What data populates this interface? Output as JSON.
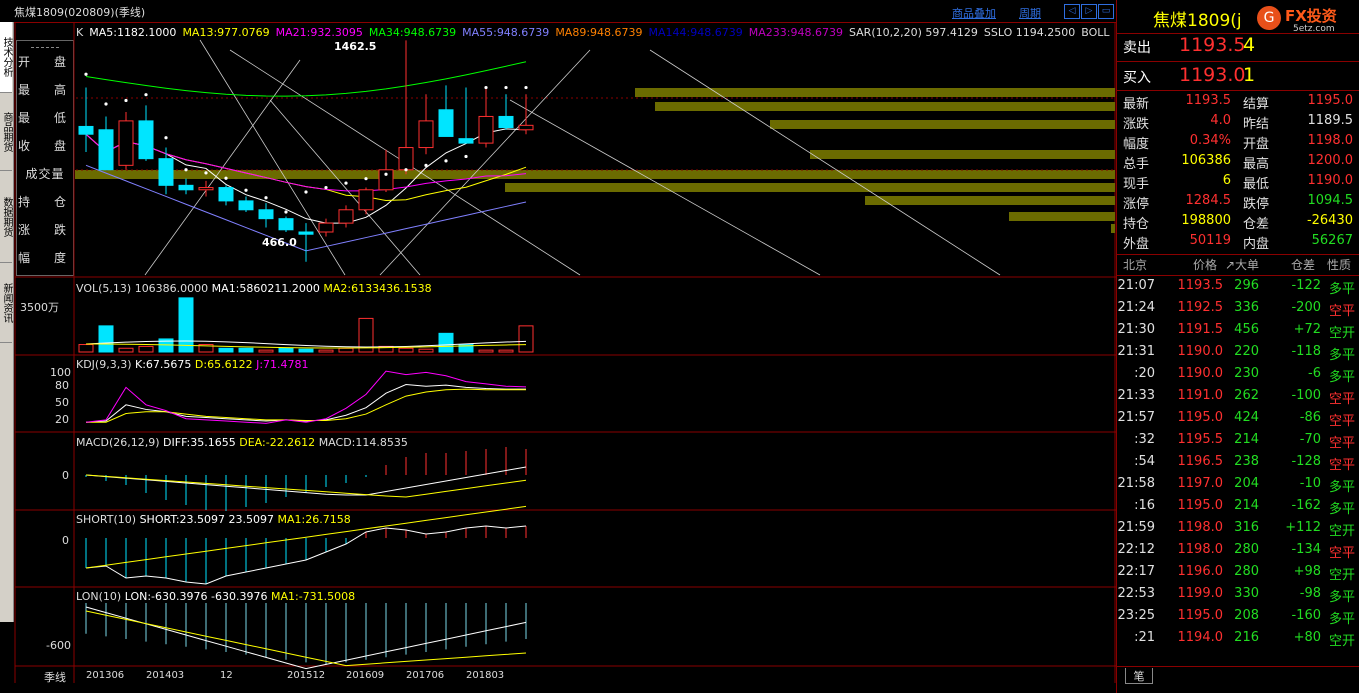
{
  "window": {
    "title": "焦煤1809(020809)(季线)",
    "links": [
      "商品叠加",
      "周期"
    ],
    "nav_buttons": [
      "◁",
      "▷",
      "▭"
    ]
  },
  "left_tabs": [
    "技术分析",
    "商品期货",
    "数据期货",
    "新闻资讯"
  ],
  "info_labels": [
    "开　盘",
    "最　高",
    "最　低",
    "收　盘",
    "成交量",
    "持　仓",
    "涨　跌",
    "幅　度"
  ],
  "main_pane": {
    "indicator_line": [
      {
        "text": "K",
        "color": "#dddddd"
      },
      {
        "text": "MA5:1182.1000",
        "color": "#ffffff"
      },
      {
        "text": "MA13:977.0769",
        "color": "#ffff00"
      },
      {
        "text": "MA21:932.3095",
        "color": "#ff00ff"
      },
      {
        "text": "MA34:948.6739",
        "color": "#00ff00"
      },
      {
        "text": "MA55:948.6739",
        "color": "#8080ff"
      },
      {
        "text": "MA89:948.6739",
        "color": "#ff8000"
      },
      {
        "text": "MA144:948.6739",
        "color": "#0000c0"
      },
      {
        "text": "MA233:948.6739",
        "color": "#c000c0"
      },
      {
        "text": "SAR(10,2,20) 597.4129",
        "color": "#dddddd"
      },
      {
        "text": "SSLO 1194.2500",
        "color": "#dddddd"
      },
      {
        "text": "BOLL",
        "color": "#dddddd"
      }
    ],
    "high_mark": "1462.5",
    "low_mark": "466.0"
  },
  "vol_pane": {
    "title": "VOL(5,13) 106386.0000",
    "ma1": "MA1:5860211.2000",
    "ma2": "MA2:6133436.1538",
    "ylabel": "3500万"
  },
  "kdj_pane": {
    "title": "KDJ(9,3,3)",
    "k": "K:67.5675",
    "d": "D:65.6122",
    "j": "J:71.4781",
    "yticks": [
      "100",
      "80",
      "50",
      "20"
    ]
  },
  "macd_pane": {
    "title": "MACD(26,12,9)",
    "diff": "DIFF:35.1655",
    "dea": "DEA:-22.2612",
    "macd": "MACD:114.8535",
    "ytick": "0"
  },
  "short_pane": {
    "title": "SHORT(10)",
    "v": "SHORT:23.5097",
    "v2": "23.5097",
    "ma": "MA1:26.7158",
    "ytick": "0"
  },
  "lon_pane": {
    "title": "LON(10)",
    "v": "LON:-630.3976",
    "v2": "-630.3976",
    "ma": "MA1:-731.5008",
    "ytick": "-600"
  },
  "x_axis": {
    "period_label": "季线",
    "dates": [
      "201306",
      "201403",
      "12",
      "201512",
      "201609",
      "201706",
      "201803"
    ]
  },
  "quote": {
    "name": "焦煤1809",
    "code_suffix": "(j",
    "logo_text": "FX投资",
    "logo_sub": "5etz.com",
    "sell_label": "卖出",
    "sell_price": "1193.5",
    "sell_qty": "4",
    "buy_label": "买入",
    "buy_price": "1193.0",
    "buy_qty": "1",
    "fields": [
      {
        "l1": "最新",
        "v1": "1193.5",
        "c1": "red",
        "l2": "结算",
        "v2": "1195.0",
        "c2": "red"
      },
      {
        "l1": "涨跌",
        "v1": "4.0",
        "c1": "red",
        "l2": "昨结",
        "v2": "1189.5",
        "c2": "wht"
      },
      {
        "l1": "幅度",
        "v1": "0.34%",
        "c1": "red",
        "l2": "开盘",
        "v2": "1198.0",
        "c2": "red"
      },
      {
        "l1": "总手",
        "v1": "106386",
        "c1": "yel",
        "l2": "最高",
        "v2": "1200.0",
        "c2": "red"
      },
      {
        "l1": "现手",
        "v1": "6",
        "c1": "yel",
        "l2": "最低",
        "v2": "1190.0",
        "c2": "red"
      },
      {
        "l1": "涨停",
        "v1": "1284.5",
        "c1": "red",
        "l2": "跌停",
        "v2": "1094.5",
        "c2": "grn"
      },
      {
        "l1": "持仓",
        "v1": "198800",
        "c1": "yel",
        "l2": "仓差",
        "v2": "-26430",
        "c2": "yel"
      },
      {
        "l1": "外盘",
        "v1": "50119",
        "c1": "red",
        "l2": "内盘",
        "v2": "56267",
        "c2": "grn"
      }
    ],
    "tick_headers": [
      "北京",
      "价格",
      "↗大单",
      "仓差",
      "性质"
    ],
    "ticks": [
      {
        "t": "21:07",
        "p": "1193.5",
        "v": "296",
        "d": "-122",
        "n": "多平",
        "pc": "red",
        "nc": "grn"
      },
      {
        "t": "21:24",
        "p": "1192.5",
        "v": "336",
        "d": "-200",
        "n": "空平",
        "pc": "red",
        "nc": "red"
      },
      {
        "t": "21:30",
        "p": "1191.5",
        "v": "456",
        "d": "+72",
        "n": "空开",
        "pc": "red",
        "nc": "grn"
      },
      {
        "t": "21:31",
        "p": "1190.0",
        "v": "220",
        "d": "-118",
        "n": "多平",
        "pc": "red",
        "nc": "grn"
      },
      {
        "t": ":20",
        "p": "1190.0",
        "v": "230",
        "d": "-6",
        "n": "多平",
        "pc": "red",
        "nc": "grn"
      },
      {
        "t": "21:33",
        "p": "1191.0",
        "v": "262",
        "d": "-100",
        "n": "空平",
        "pc": "red",
        "nc": "red"
      },
      {
        "t": "21:57",
        "p": "1195.0",
        "v": "424",
        "d": "-86",
        "n": "空平",
        "pc": "red",
        "nc": "red"
      },
      {
        "t": ":32",
        "p": "1195.5",
        "v": "214",
        "d": "-70",
        "n": "空平",
        "pc": "red",
        "nc": "red"
      },
      {
        "t": ":54",
        "p": "1196.5",
        "v": "238",
        "d": "-128",
        "n": "空平",
        "pc": "red",
        "nc": "red"
      },
      {
        "t": "21:58",
        "p": "1197.0",
        "v": "204",
        "d": "-10",
        "n": "多平",
        "pc": "red",
        "nc": "grn"
      },
      {
        "t": ":16",
        "p": "1195.0",
        "v": "214",
        "d": "-162",
        "n": "多平",
        "pc": "red",
        "nc": "grn"
      },
      {
        "t": "21:59",
        "p": "1198.0",
        "v": "316",
        "d": "+112",
        "n": "空开",
        "pc": "red",
        "nc": "grn"
      },
      {
        "t": "22:12",
        "p": "1198.0",
        "v": "280",
        "d": "-134",
        "n": "空平",
        "pc": "red",
        "nc": "red"
      },
      {
        "t": "22:17",
        "p": "1196.0",
        "v": "280",
        "d": "+98",
        "n": "空开",
        "pc": "red",
        "nc": "grn"
      },
      {
        "t": "22:53",
        "p": "1199.0",
        "v": "330",
        "d": "-98",
        "n": "多平",
        "pc": "red",
        "nc": "grn"
      },
      {
        "t": "23:25",
        "p": "1195.0",
        "v": "208",
        "d": "-160",
        "n": "多平",
        "pc": "red",
        "nc": "grn"
      },
      {
        "t": ":21",
        "p": "1194.0",
        "v": "216",
        "d": "+80",
        "n": "空开",
        "pc": "red",
        "nc": "grn"
      }
    ],
    "footer_tab": "笔"
  },
  "chart_data": {
    "type": "candlestick",
    "period": "季线",
    "candles": [
      {
        "o": 1075,
        "h": 1250,
        "l": 960,
        "c": 1040
      },
      {
        "o": 1060,
        "h": 1120,
        "l": 880,
        "c": 880
      },
      {
        "o": 900,
        "h": 1140,
        "l": 880,
        "c": 1100
      },
      {
        "o": 1100,
        "h": 1170,
        "l": 920,
        "c": 930
      },
      {
        "o": 930,
        "h": 980,
        "l": 770,
        "c": 810
      },
      {
        "o": 810,
        "h": 840,
        "l": 770,
        "c": 790
      },
      {
        "o": 790,
        "h": 830,
        "l": 760,
        "c": 800
      },
      {
        "o": 800,
        "h": 810,
        "l": 720,
        "c": 740
      },
      {
        "o": 740,
        "h": 760,
        "l": 690,
        "c": 700
      },
      {
        "o": 700,
        "h": 730,
        "l": 620,
        "c": 660
      },
      {
        "o": 660,
        "h": 670,
        "l": 600,
        "c": 610
      },
      {
        "o": 600,
        "h": 640,
        "l": 466,
        "c": 590
      },
      {
        "o": 600,
        "h": 660,
        "l": 580,
        "c": 640
      },
      {
        "o": 640,
        "h": 720,
        "l": 620,
        "c": 700
      },
      {
        "o": 700,
        "h": 800,
        "l": 680,
        "c": 790
      },
      {
        "o": 790,
        "h": 970,
        "l": 780,
        "c": 880
      },
      {
        "o": 880,
        "h": 1462.5,
        "l": 860,
        "c": 980
      },
      {
        "o": 980,
        "h": 1220,
        "l": 950,
        "c": 1100
      },
      {
        "o": 1150,
        "h": 1260,
        "l": 1030,
        "c": 1030
      },
      {
        "o": 1020,
        "h": 1250,
        "l": 1000,
        "c": 1000
      },
      {
        "o": 1000,
        "h": 1250,
        "l": 980,
        "c": 1120
      },
      {
        "o": 1120,
        "h": 1220,
        "l": 1060,
        "c": 1070
      },
      {
        "o": 1060,
        "h": 1220,
        "l": 1040,
        "c": 1080
      }
    ],
    "ylim": [
      420,
      1500
    ],
    "volume": [
      8,
      28,
      4,
      6,
      14,
      58,
      8,
      4,
      4,
      2,
      4,
      3,
      2,
      4,
      36,
      6,
      4,
      3,
      20,
      8,
      2,
      2,
      28
    ],
    "volume_colors": [
      "up",
      "down",
      "up",
      "up",
      "down",
      "down",
      "up",
      "down",
      "down",
      "up",
      "down",
      "down",
      "up",
      "up",
      "up",
      "up",
      "up",
      "up",
      "down",
      "down",
      "up",
      "up",
      "up"
    ],
    "macd_hist": [
      -2,
      -6,
      -10,
      -18,
      -25,
      -30,
      -35,
      -36,
      -32,
      -28,
      -22,
      -18,
      -12,
      -8,
      -2,
      10,
      18,
      22,
      22,
      24,
      26,
      28,
      26
    ],
    "short_hist": [
      -30,
      -28,
      -40,
      -38,
      -40,
      -44,
      -46,
      -38,
      -34,
      -30,
      -26,
      -22,
      -14,
      -6,
      6,
      10,
      8,
      4,
      6,
      10,
      12,
      10,
      12
    ]
  }
}
